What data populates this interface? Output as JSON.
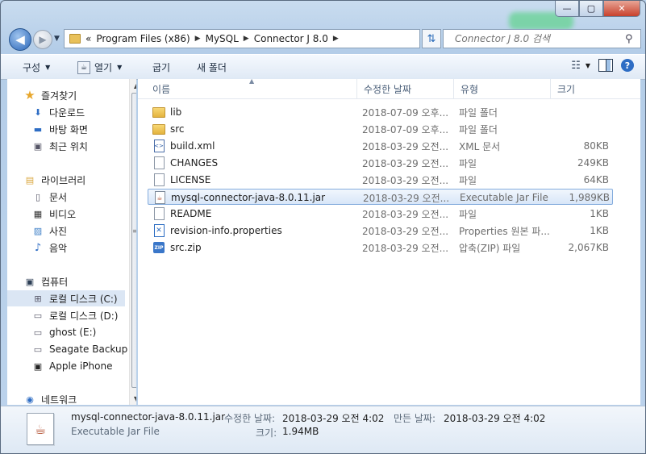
{
  "window": {
    "minimize_glyph": "—",
    "maximize_glyph": "▢",
    "close_glyph": "✕"
  },
  "address": {
    "overflow": "«",
    "crumbs": [
      "Program Files (x86)",
      "MySQL",
      "Connector J 8.0"
    ],
    "search_placeholder": "Connector J 8.0 검색"
  },
  "toolbar": {
    "organize": "구성",
    "open": "열기",
    "burn": "굽기",
    "new_folder": "새 폴더"
  },
  "nav": {
    "favorites": "즐겨찾기",
    "downloads": "다운로드",
    "desktop": "바탕 화면",
    "recent": "최근 위치",
    "libraries": "라이브러리",
    "documents": "문서",
    "videos": "비디오",
    "pictures": "사진",
    "music": "음악",
    "computer": "컴퓨터",
    "local_c": "로컬 디스크 (C:)",
    "local_d": "로컬 디스크 (D:)",
    "ghost": "ghost (E:)",
    "seagate": "Seagate Backup",
    "iphone": "Apple iPhone",
    "network": "네트워크"
  },
  "columns": {
    "name": "이름",
    "date": "수정한 날짜",
    "type": "유형",
    "size": "크기"
  },
  "files": [
    {
      "name": "lib",
      "date": "2018-07-09 오후...",
      "type": "파일 폴더",
      "size": "",
      "icon": "folder-icon"
    },
    {
      "name": "src",
      "date": "2018-07-09 오후...",
      "type": "파일 폴더",
      "size": "",
      "icon": "folder-icon"
    },
    {
      "name": "build.xml",
      "date": "2018-03-29 오전...",
      "type": "XML 문서",
      "size": "80KB",
      "icon": "xml-file-icon"
    },
    {
      "name": "CHANGES",
      "date": "2018-03-29 오전...",
      "type": "파일",
      "size": "249KB",
      "icon": "file-icon"
    },
    {
      "name": "LICENSE",
      "date": "2018-03-29 오전...",
      "type": "파일",
      "size": "64KB",
      "icon": "file-icon"
    },
    {
      "name": "mysql-connector-java-8.0.11.jar",
      "date": "2018-03-29 오전...",
      "type": "Executable Jar File",
      "size": "1,989KB",
      "icon": "jar-file-icon"
    },
    {
      "name": "README",
      "date": "2018-03-29 오전...",
      "type": "파일",
      "size": "1KB",
      "icon": "file-icon"
    },
    {
      "name": "revision-info.properties",
      "date": "2018-03-29 오전...",
      "type": "Properties 원본 파...",
      "size": "1KB",
      "icon": "properties-file-icon"
    },
    {
      "name": "src.zip",
      "date": "2018-03-29 오전...",
      "type": "압축(ZIP) 파일",
      "size": "2,067KB",
      "icon": "zip-file-icon"
    }
  ],
  "details": {
    "name": "mysql-connector-java-8.0.11.jar",
    "type": "Executable Jar File",
    "modified_label": "수정한 날짜:",
    "modified_value": "2018-03-29 오전 4:02",
    "created_label": "만든 날짜:",
    "created_value": "2018-03-29 오전 4:02",
    "size_label": "크기:",
    "size_value": "1.94MB"
  }
}
